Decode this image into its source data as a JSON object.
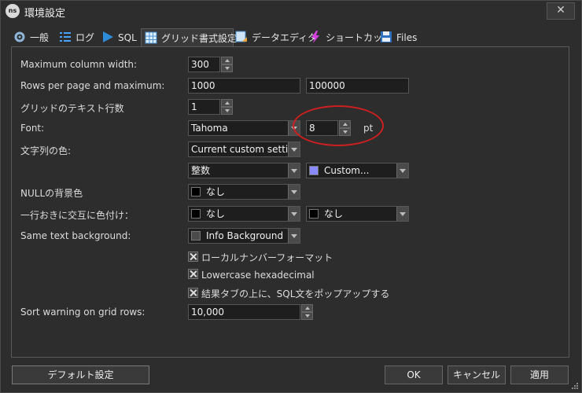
{
  "window": {
    "title": "環境設定",
    "app_badge": "ns",
    "close_glyph": "✕"
  },
  "tabs": [
    {
      "label": "一般",
      "icon": "gear-icon"
    },
    {
      "label": "ログ",
      "icon": "list-icon"
    },
    {
      "label": "SQL",
      "icon": "play-icon"
    },
    {
      "label": "グリッド書式設定",
      "icon": "grid-icon",
      "active": true
    },
    {
      "label": "データエディタ",
      "icon": "data-editor-icon"
    },
    {
      "label": "ショートカット",
      "icon": "lightning-icon"
    },
    {
      "label": "Files",
      "icon": "save-icon"
    }
  ],
  "form": {
    "max_col_width": {
      "label": "Maximum column width:",
      "value": "300"
    },
    "rows_per_page": {
      "label": "Rows per page and maximum:",
      "value": "1000",
      "max": "100000"
    },
    "text_rows": {
      "label": "グリッドのテキスト行数",
      "value": "1"
    },
    "font": {
      "label": "Font:",
      "value": "Tahoma",
      "size": "8",
      "unit": "pt"
    },
    "string_color": {
      "label": "文字列の色:",
      "value": "Current custom setting"
    },
    "type_row": {
      "value": "整数",
      "color": "Custom...",
      "swatch": "#8a8aff"
    },
    "null_bg": {
      "label": "NULLの背景色",
      "value": "なし",
      "swatch": "#000000"
    },
    "alt_color": {
      "label": "一行おきに交互に色付け：",
      "value1": "なし",
      "value2": "なし",
      "swatch": "#000000"
    },
    "same_text_bg": {
      "label": "Same text background:",
      "value": "Info Background",
      "swatch": "#4a4a4a"
    },
    "checks": [
      "ローカルナンバーフォーマット",
      "Lowercase hexadecimal",
      "結果タブの上に、SQL文をポップアップする"
    ],
    "sort_warning": {
      "label": "Sort warning on grid rows:",
      "value": "10,000"
    }
  },
  "buttons": {
    "default": "デフォルト設定",
    "ok": "OK",
    "cancel": "キャンセル",
    "apply": "適用"
  },
  "colors": {
    "accent_circle": "#cc1f1f"
  }
}
